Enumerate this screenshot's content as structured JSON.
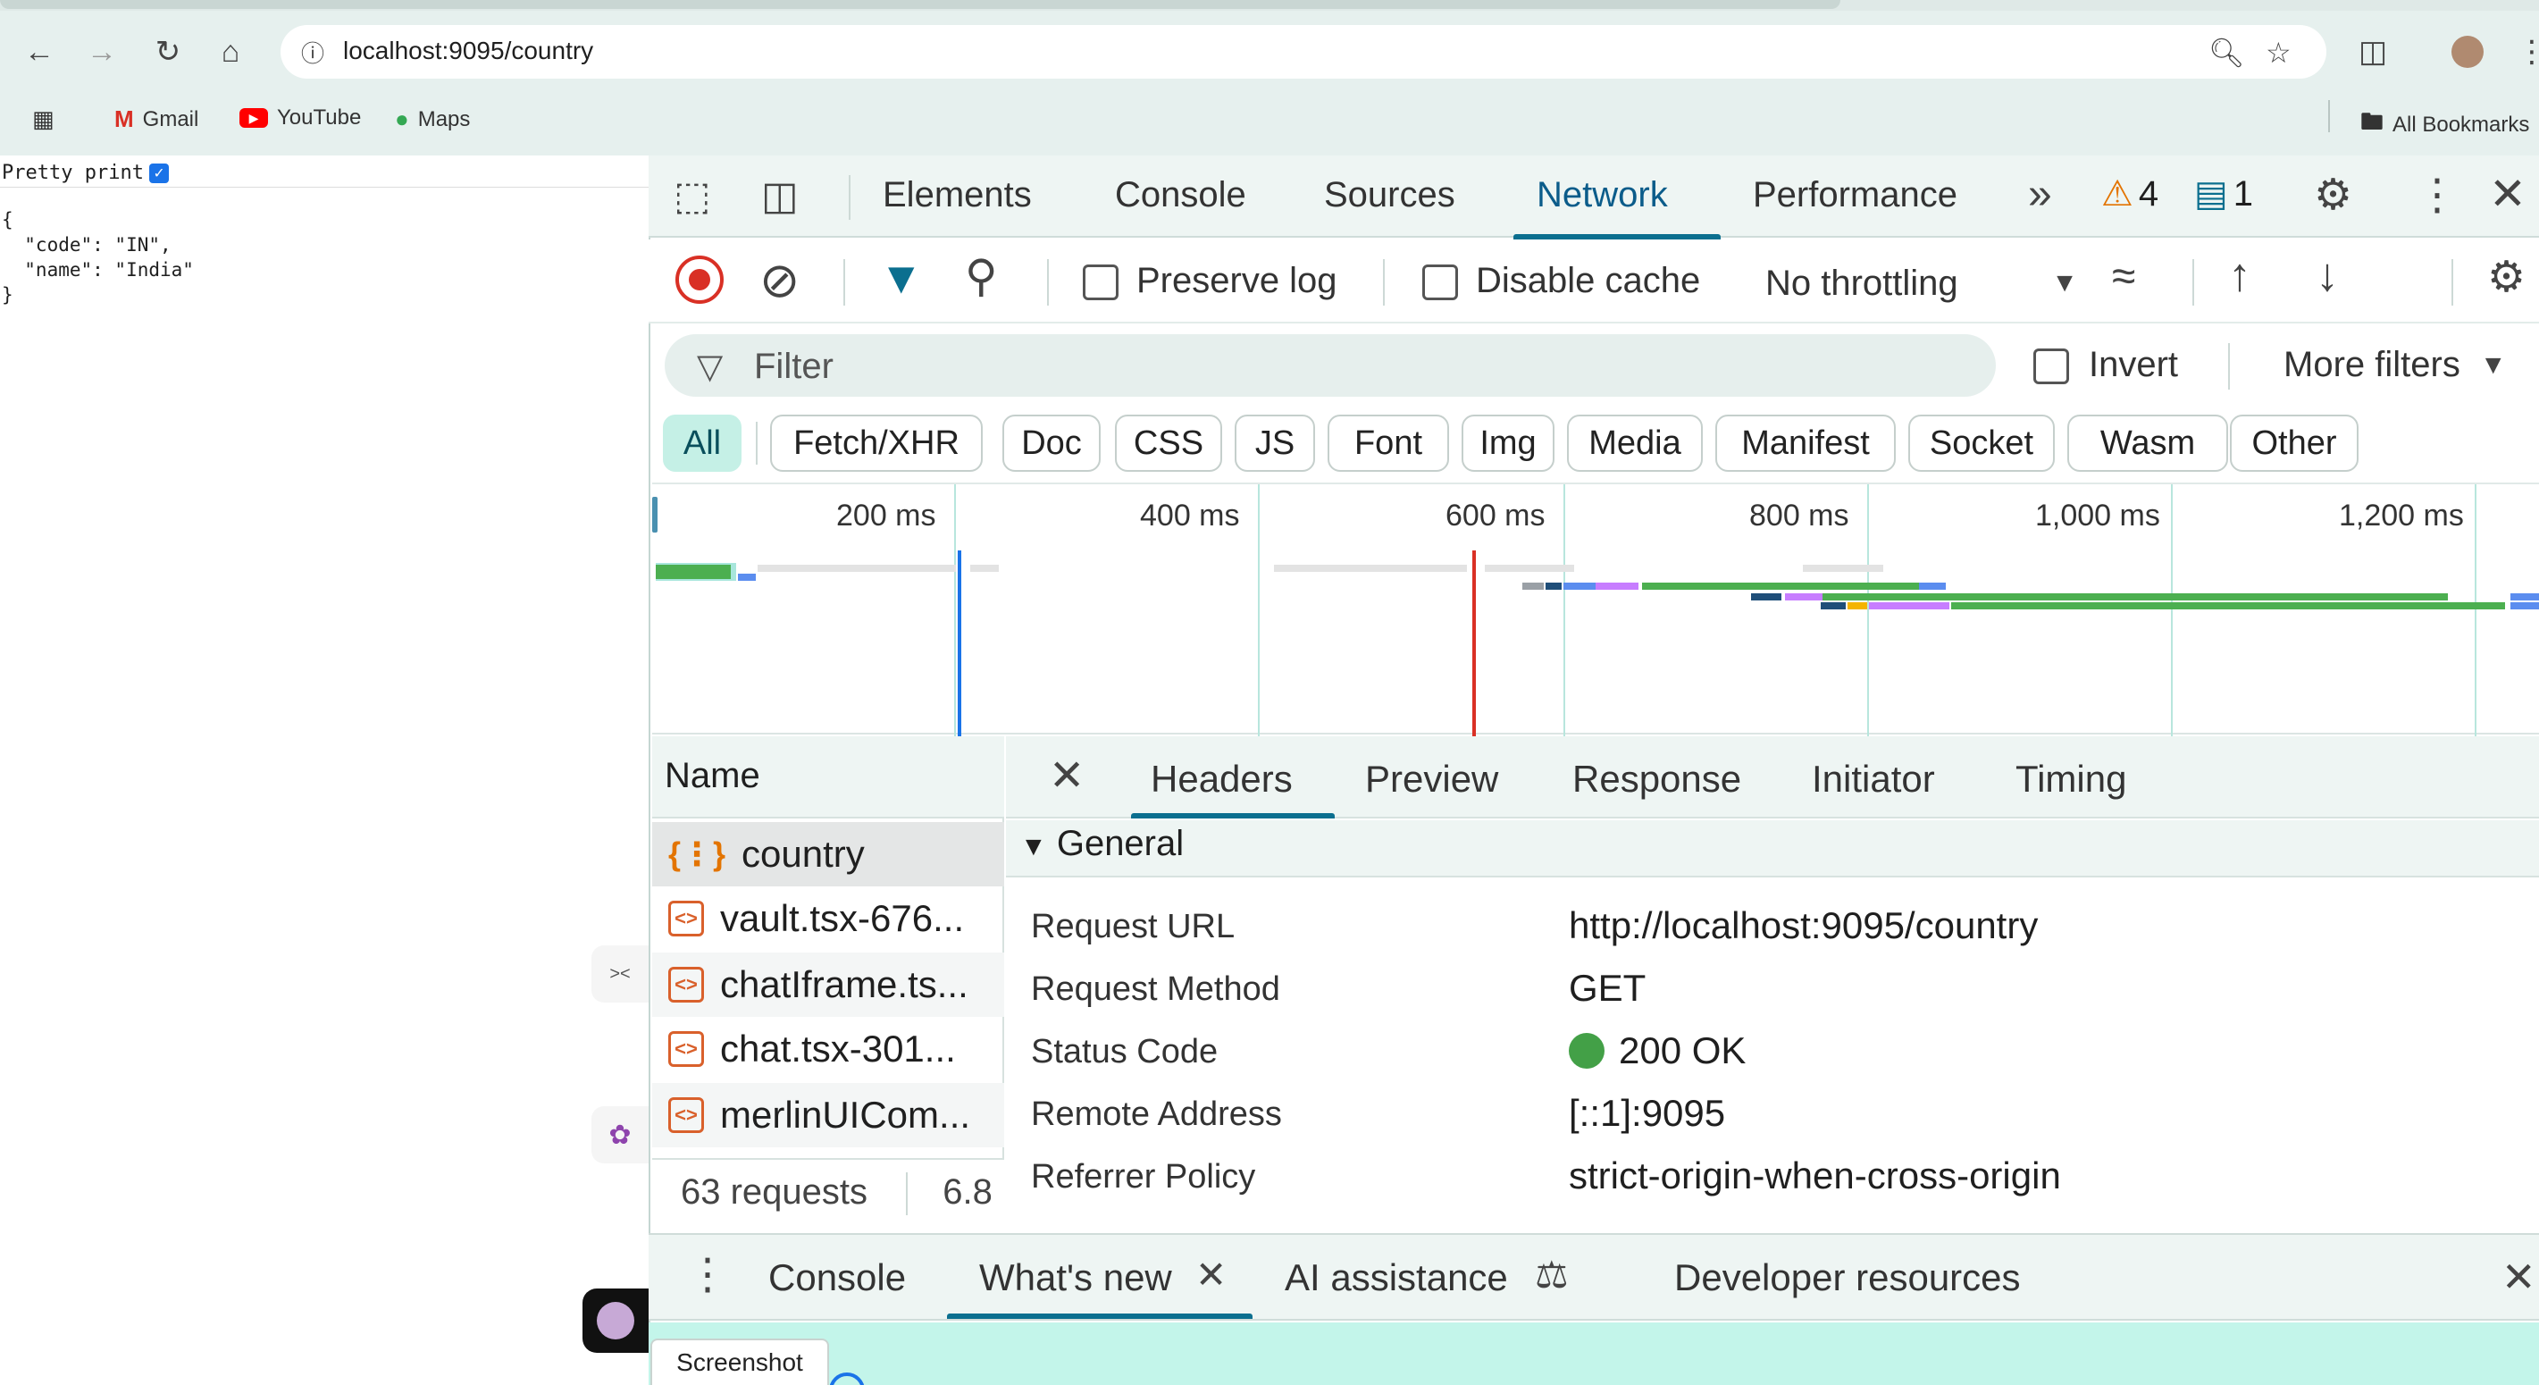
{
  "browser": {
    "url": "localhost:9095/country",
    "bookmarks": [
      {
        "label": "Gmail",
        "icon": "gmail-icon"
      },
      {
        "label": "YouTube",
        "icon": "youtube-icon"
      },
      {
        "label": "Maps",
        "icon": "maps-icon"
      }
    ],
    "all_bookmarks": "All Bookmarks"
  },
  "page": {
    "pretty_print_label": "Pretty print",
    "pretty_print_checked": true,
    "json_text": "{\n  \"code\": \"IN\",\n  \"name\": \"India\"\n}"
  },
  "devtools": {
    "tabs": [
      "Elements",
      "Console",
      "Sources",
      "Network",
      "Performance"
    ],
    "active_tab": "Network",
    "warning_count": "4",
    "message_count": "1",
    "toolbar": {
      "preserve_log": "Preserve log",
      "disable_cache": "Disable cache",
      "throttling": "No throttling"
    },
    "filter": {
      "placeholder": "Filter",
      "invert": "Invert",
      "more_filters": "More filters"
    },
    "type_filters": [
      "All",
      "Fetch/XHR",
      "Doc",
      "CSS",
      "JS",
      "Font",
      "Img",
      "Media",
      "Manifest",
      "Socket",
      "Wasm",
      "Other"
    ],
    "active_type_filter": "All",
    "timeline": {
      "ticks": [
        "200 ms",
        "400 ms",
        "600 ms",
        "800 ms",
        "1,000 ms",
        "1,200 ms"
      ]
    },
    "requests": {
      "name_header": "Name",
      "rows": [
        "country",
        "vault.tsx-676...",
        "chatIframe.ts...",
        "chat.tsx-301...",
        "merlinUICom..."
      ],
      "summary": "63 requests",
      "summary_size": "6.8"
    },
    "detail": {
      "tabs": [
        "Headers",
        "Preview",
        "Response",
        "Initiator",
        "Timing"
      ],
      "active_tab": "Headers",
      "section": "General",
      "headers": [
        {
          "key": "Request URL",
          "value": "http://localhost:9095/country"
        },
        {
          "key": "Request Method",
          "value": "GET"
        },
        {
          "key": "Status Code",
          "value": "200 OK"
        },
        {
          "key": "Remote Address",
          "value": "[::1]:9095"
        },
        {
          "key": "Referrer Policy",
          "value": "strict-origin-when-cross-origin"
        }
      ],
      "status_color": "#43a047"
    },
    "drawer": {
      "tabs": [
        "Console",
        "What's new",
        "AI assistance",
        "Developer resources"
      ],
      "active_tab": "What's new",
      "screenshot_button": "Screenshot"
    },
    "colors": {
      "accent": "#0b6f8f",
      "record": "#d93025",
      "chip_active": "#c5f0e6"
    }
  }
}
